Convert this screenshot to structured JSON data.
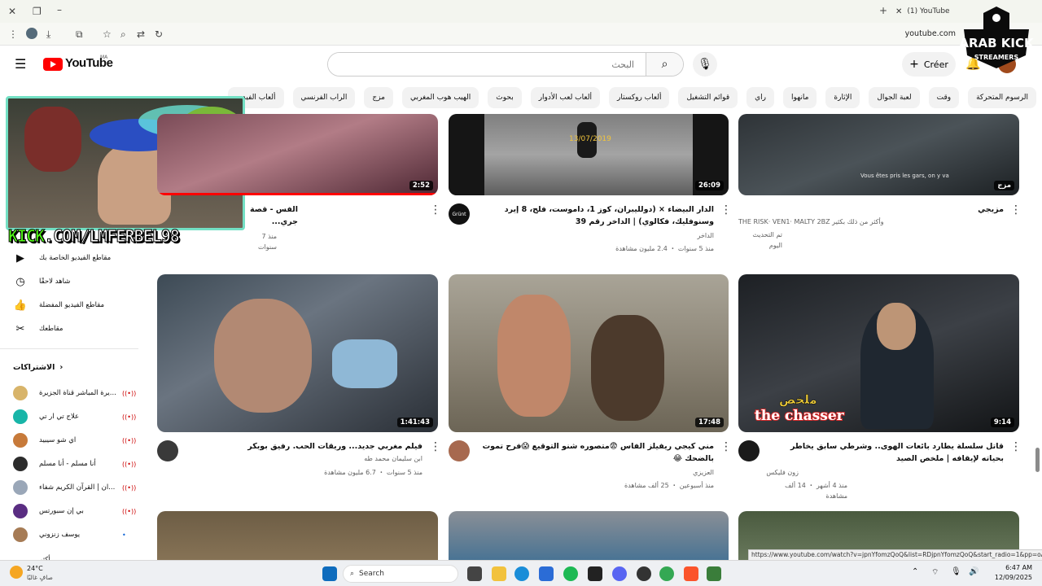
{
  "browser": {
    "tab_title": "(1) YouTube",
    "address": "youtube.com"
  },
  "header": {
    "logo_text": "YouTube",
    "country_code": "MA",
    "search_placeholder": "البحث",
    "create_label": "Créer",
    "notifications_count": "9+"
  },
  "chips": [
    "الرسوم المتحركة",
    "وقت",
    "لعبة الجوال",
    "الإثارة",
    "مانهوا",
    "راي",
    "قوائم التشغيل",
    "ألعاب روكستار",
    "ألعاب لعب الأدوار",
    "بحوث",
    "الهيب هوب المغربي",
    "مزج",
    "الراب الفرنسي",
    "ألعاب الفيديو"
  ],
  "overlay": {
    "kick_prefix": "KICK",
    "kick_rest": ".COM/LMFERBEL98",
    "badge_line1": "ARAB KICK",
    "badge_line2": "STREAMERS"
  },
  "sidebar": {
    "items": [
      {
        "label": "مقاطع الفيديو الخاصة بك",
        "icon": "play-square-icon"
      },
      {
        "label": "شاهد لاحقًا",
        "icon": "clock-icon"
      },
      {
        "label": "مقاطع الفيديو المفضلة",
        "icon": "thumb-up-icon"
      },
      {
        "label": "مقاطعك",
        "icon": "scissors-icon"
      }
    ],
    "subscriptions_title": "الاشتراكات",
    "subscriptions": [
      {
        "label": "...يرة المباشر قناة الجزيرة",
        "color": "#d8b46a",
        "live": true
      },
      {
        "label": "علاج تي ار تي",
        "color": "#18b5a8",
        "live": true
      },
      {
        "label": "اي شو سيبيد",
        "color": "#c77a3a",
        "live": true
      },
      {
        "label": "أنا مسلم - أنا مسلم",
        "color": "#2c2c2c",
        "live": true
      },
      {
        "label": "...ان | القرآن الكريم شفاء",
        "color": "#9aa7b8",
        "live": true
      },
      {
        "label": "بي إن سبورتس",
        "color": "#5a2d82",
        "live": true
      },
      {
        "label": "يوسف زنزوني",
        "color": "#a67b55",
        "live": false
      }
    ],
    "more_label": "أكثر"
  },
  "videos": [
    {
      "title": "الفس - قصة جري...",
      "channel": "",
      "meta": "منذ 7 سنوات",
      "duration": "2:52"
    },
    {
      "title": "الدار البيضاء × (دولليبران، كوز 1، داموست، فلج، 8 إيرد وسنوفليك، فكالوي) | الداخر رقم 39",
      "channel": "الداخر",
      "meta": "منذ 5 سنوات ・ 2.4 مليون مشاهدة",
      "duration": "26:09",
      "thumb_caption": "13/07/2019",
      "avatar_text": "Grünt"
    },
    {
      "title": "مزيجي",
      "channel": "THE RISK· VEN1· MALTY 2BZ وأكثر من ذلك بكثير",
      "meta": "تم التحديث اليوم",
      "duration": "مزج",
      "thumb_caption": "Vous êtes pris les gars, on y va"
    },
    {
      "title": "فيلم مغربي جديد... وريقات الحب. رفيق بوبكر",
      "channel": "ابن سليمان محمد طه",
      "meta": "منذ 5 سنوات ・ 6.7 مليون مشاهدة",
      "duration": "1:41:43"
    },
    {
      "title": "مني كيجي ريفيلز الفاس 😨متصوره شنو التوقيع 😱فرح تموت بالضحك 😂",
      "channel": "العزيزي",
      "meta": "منذ أسبوعين ・ 25 ألف مشاهدة",
      "duration": "17:48"
    },
    {
      "title": "قاتل سلسلة يطارد بائعات الهوى.. وشرطي سابق يخاطر بحياته لإيقافه | ملخص الصيد",
      "channel": "زون فليكس",
      "meta": "منذ 4 أشهر ・ 14 ألف مشاهدة",
      "duration": "9:14",
      "thumb_caption_ar": "ملخص",
      "thumb_caption_en": "the chasser"
    }
  ],
  "status_url": "https://www.youtube.com/watch?v=jpnYfomzQoQ&list=RDjpnYfomzQoQ&start_radio=1&pp=oAcB",
  "taskbar": {
    "weather_temp": "24°C",
    "weather_desc": "صافٍ غالبًا",
    "search_label": "Search",
    "time": "6:47 AM",
    "date": "12/09/2025"
  },
  "colors": {
    "youtube_red": "#ff0000",
    "kick_green": "#53fc18",
    "webcam_border": "#73e0c4"
  }
}
